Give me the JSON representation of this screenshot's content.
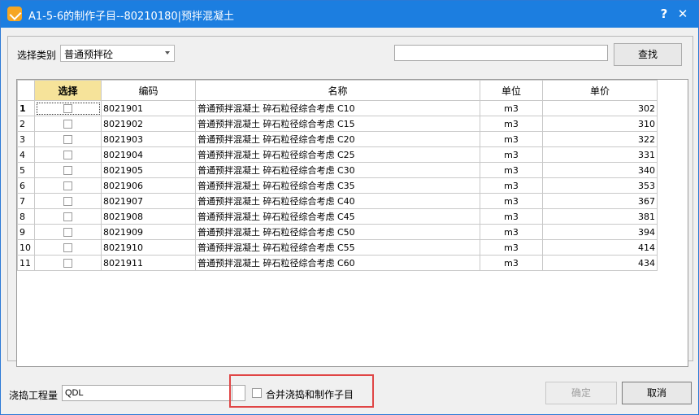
{
  "window": {
    "title": "A1-5-6的制作子目--80210180|预拌混凝土",
    "help_label": "?",
    "close_label": "✕"
  },
  "filter": {
    "category_label": "选择类别",
    "category_value": "普通预拌砼",
    "search_value": "",
    "search_button": "查找"
  },
  "table": {
    "headers": [
      "",
      "选择",
      "编码",
      "名称",
      "单位",
      "单价"
    ],
    "rows": [
      {
        "n": "1",
        "code": "8021901",
        "name": "普通预拌混凝土 碎石粒径综合考虑 C10",
        "unit": "m3",
        "price": "302"
      },
      {
        "n": "2",
        "code": "8021902",
        "name": "普通预拌混凝土 碎石粒径综合考虑 C15",
        "unit": "m3",
        "price": "310"
      },
      {
        "n": "3",
        "code": "8021903",
        "name": "普通预拌混凝土 碎石粒径综合考虑 C20",
        "unit": "m3",
        "price": "322"
      },
      {
        "n": "4",
        "code": "8021904",
        "name": "普通预拌混凝土 碎石粒径综合考虑 C25",
        "unit": "m3",
        "price": "331"
      },
      {
        "n": "5",
        "code": "8021905",
        "name": "普通预拌混凝土 碎石粒径综合考虑 C30",
        "unit": "m3",
        "price": "340"
      },
      {
        "n": "6",
        "code": "8021906",
        "name": "普通预拌混凝土 碎石粒径综合考虑 C35",
        "unit": "m3",
        "price": "353"
      },
      {
        "n": "7",
        "code": "8021907",
        "name": "普通预拌混凝土 碎石粒径综合考虑 C40",
        "unit": "m3",
        "price": "367"
      },
      {
        "n": "8",
        "code": "8021908",
        "name": "普通预拌混凝土 碎石粒径综合考虑 C45",
        "unit": "m3",
        "price": "381"
      },
      {
        "n": "9",
        "code": "8021909",
        "name": "普通预拌混凝土 碎石粒径综合考虑 C50",
        "unit": "m3",
        "price": "394"
      },
      {
        "n": "10",
        "code": "8021910",
        "name": "普通预拌混凝土 碎石粒径综合考虑 C55",
        "unit": "m3",
        "price": "414"
      },
      {
        "n": "11",
        "code": "8021911",
        "name": "普通预拌混凝土 碎石粒径综合考虑 C60",
        "unit": "m3",
        "price": "434"
      }
    ]
  },
  "footer": {
    "quantity_label": "浇捣工程量",
    "quantity_value": "QDL",
    "merge_label": "合并浇捣和制作子目",
    "ok_button": "确定",
    "cancel_button": "取消"
  },
  "colors": {
    "titlebar": "#1c7ee0",
    "highlight_border": "#e04545",
    "selected_header": "#f6e39a"
  }
}
